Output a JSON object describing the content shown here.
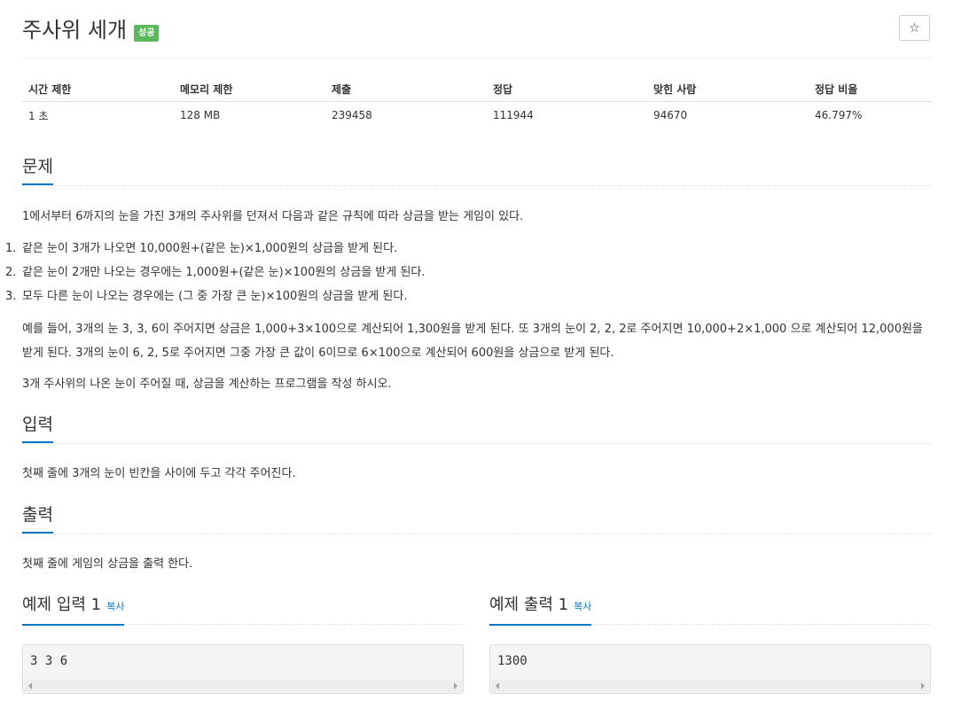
{
  "header": {
    "title": "주사위 세개",
    "badge": "성공",
    "star_icon": "☆"
  },
  "info_table": {
    "headers": [
      "시간 제한",
      "메모리 제한",
      "제출",
      "정답",
      "맞힌 사람",
      "정답 비율"
    ],
    "values": [
      "1 초",
      "128 MB",
      "239458",
      "111944",
      "94670",
      "46.797%"
    ]
  },
  "problem": {
    "heading": "문제",
    "intro": "1에서부터 6까지의 눈을 가진 3개의 주사위를 던져서 다음과 같은 규칙에 따라 상금을 받는 게임이 있다.",
    "rules": [
      {
        "num": "1.",
        "text": "같은 눈이 3개가 나오면 10,000원+(같은 눈)×1,000원의 상금을 받게 된다."
      },
      {
        "num": "2.",
        "text": "같은 눈이 2개만 나오는 경우에는 1,000원+(같은 눈)×100원의 상금을 받게 된다."
      },
      {
        "num": "3.",
        "text": "모두 다른 눈이 나오는 경우에는 (그 중 가장 큰 눈)×100원의 상금을 받게 된다."
      }
    ],
    "example": "예를 들어, 3개의 눈 3, 3, 6이 주어지면 상금은 1,000+3×100으로 계산되어 1,300원을 받게 된다. 또 3개의 눈이 2, 2, 2로 주어지면 10,000+2×1,000 으로 계산되어 12,000원을 받게 된다. 3개의 눈이 6, 2, 5로 주어지면 그중 가장 큰 값이 6이므로 6×100으로 계산되어 600원을 상금으로 받게 된다.",
    "task": "3개 주사위의 나온 눈이 주어질 때, 상금을 계산하는 프로그램을 작성 하시오."
  },
  "input_section": {
    "heading": "입력",
    "text": "첫째 줄에 3개의 눈이 빈칸을 사이에 두고 각각 주어진다."
  },
  "output_section": {
    "heading": "출력",
    "text": "첫째 줄에 게임의 상금을 출력 한다."
  },
  "samples": {
    "input": {
      "heading": "예제 입력 1",
      "copy_label": "복사",
      "content": "3 3 6"
    },
    "output": {
      "heading": "예제 출력 1",
      "copy_label": "복사",
      "content": "1300"
    }
  },
  "colors": {
    "accent": "#0077c6",
    "success_badge": "#5cb85c"
  }
}
